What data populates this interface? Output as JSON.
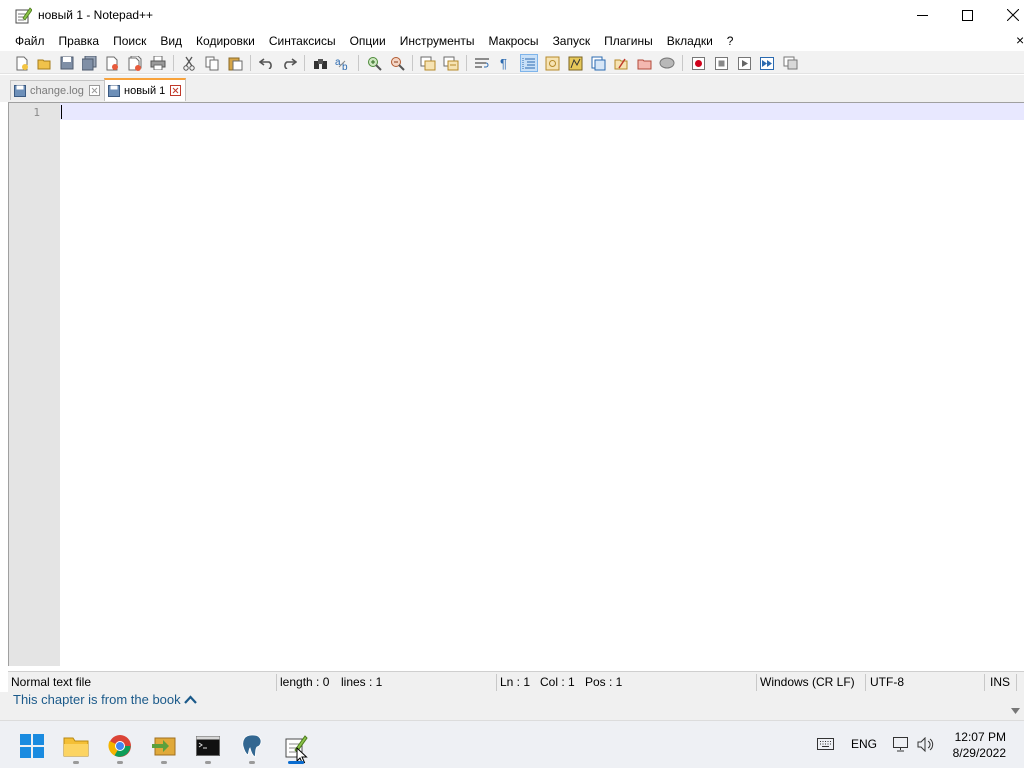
{
  "window": {
    "title": "новый 1 - Notepad++"
  },
  "menu": {
    "items": [
      "Файл",
      "Правка",
      "Поиск",
      "Вид",
      "Кодировки",
      "Синтаксисы",
      "Опции",
      "Инструменты",
      "Макросы",
      "Запуск",
      "Плагины",
      "Вкладки",
      "?"
    ],
    "overflow_close": "×"
  },
  "tabs": [
    {
      "label": "change.log",
      "active": false
    },
    {
      "label": "новый 1",
      "active": true
    }
  ],
  "editor": {
    "line_number": "1",
    "content": ""
  },
  "status": {
    "filetype": "Normal text file",
    "length": "length : 0",
    "lines": "lines : 1",
    "ln": "Ln : 1",
    "col": "Col : 1",
    "pos": "Pos : 1",
    "eol": "Windows (CR LF)",
    "encoding": "UTF-8",
    "mode": "INS"
  },
  "book": {
    "text": "This chapter is from the book"
  },
  "tray": {
    "language": "ENG",
    "time": "12:07 PM",
    "date": "8/29/2022"
  },
  "colors": {
    "accent_tab": "#f8a23a",
    "current_line": "#e8e8ff",
    "taskbar_active": "#0a6ccf",
    "book_link": "#1b5a8a"
  },
  "icons": {
    "toolbar": [
      "new-file",
      "open-file",
      "save",
      "save-all",
      "close",
      "close-all",
      "print",
      "cut",
      "copy",
      "paste",
      "undo",
      "redo",
      "find",
      "replace",
      "zoom-in",
      "zoom-out",
      "sync-vertical",
      "sync-horizontal",
      "word-wrap",
      "show-all-chars",
      "indent-guide",
      "user-defined-language",
      "doc-map",
      "function-list",
      "folder-as-workspace",
      "monitoring",
      "macro-record",
      "macro-stop",
      "macro-play",
      "macro-run-multiple",
      "macro-save"
    ],
    "taskbar": [
      "start",
      "file-explorer",
      "chrome",
      "file-transfer",
      "terminal",
      "postgresql",
      "notepad-plus-plus"
    ]
  }
}
